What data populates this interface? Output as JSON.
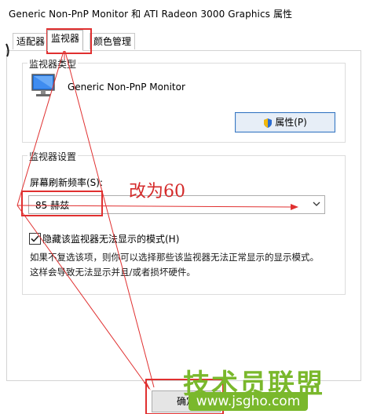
{
  "window": {
    "title": "Generic Non-PnP Monitor 和 ATI Radeon 3000 Graphics 属性"
  },
  "tabs": [
    {
      "label": "适配器"
    },
    {
      "label": "监视器"
    },
    {
      "label": "颜色管理"
    }
  ],
  "monitor_type": {
    "group_title": "监视器类型",
    "monitor_name": "Generic Non-PnP Monitor",
    "properties_button": "属性(P)"
  },
  "monitor_settings": {
    "group_title": "监视器设置",
    "refresh_label": "屏幕刷新频率(S):",
    "refresh_value": "85 赫兹",
    "hide_modes_checked": true,
    "hide_modes_label": "隐藏该监视器无法显示的模式(H)",
    "help_line1": "如果不复选该项，则你可以选择那些该监视器无法正常显示的显示模式。",
    "help_line2": "这样会导致无法显示并且/或者损坏硬件。"
  },
  "footer": {
    "ok_button": "确定"
  },
  "annotation": {
    "text": "改为60",
    "color": "#d42a2a"
  },
  "watermark": {
    "text": "技术员联盟",
    "url": "www.jsgho.com",
    "color": "#7ab82c"
  }
}
